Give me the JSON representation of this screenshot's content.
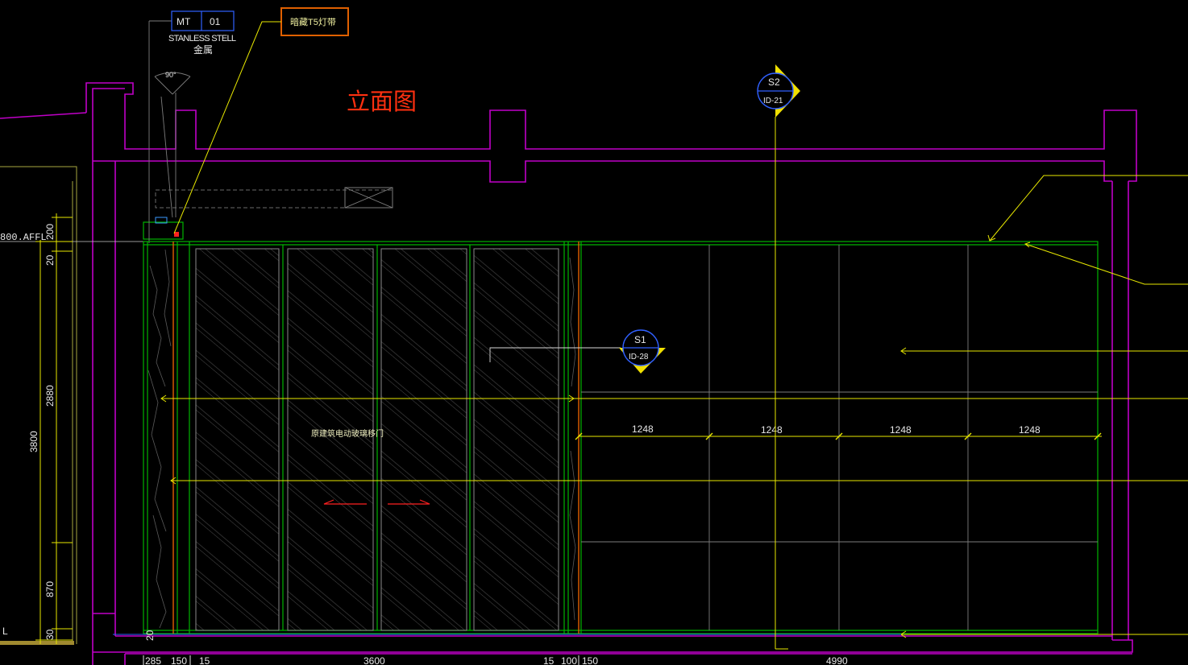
{
  "title": "立面图",
  "material_tag": {
    "code": "MT",
    "number": "01",
    "name_en": "STANLESS STELL",
    "name_cn": "金属"
  },
  "light_strip_label": "暗藏T5灯带",
  "angle_label": "90°",
  "section_markers": [
    {
      "id": "S2",
      "ref": "ID-21"
    },
    {
      "id": "S1",
      "ref": "ID-28"
    }
  ],
  "door_label": "原建筑电动玻璃移门",
  "panel_dimensions": [
    "1248",
    "1248",
    "1248",
    "1248"
  ],
  "height_dimensions": {
    "affl": "800.AFFL",
    "d200": "200",
    "d20": "20",
    "d2880": "2880",
    "d3800": "3800",
    "d870": "870",
    "d30": "30",
    "d20_floor": "20"
  },
  "width_dimensions": [
    "285",
    "150",
    "15",
    "3600",
    "15",
    "100",
    "150",
    "4990"
  ],
  "level_mark": "L",
  "colors": {
    "background": "#000000",
    "wall_outline": "#c000c8",
    "finish_outline": "#00b400",
    "dimension": "#e8e800",
    "light_strip": "#e06000",
    "title": "#ff3010",
    "section_circle": "#3060ff"
  }
}
